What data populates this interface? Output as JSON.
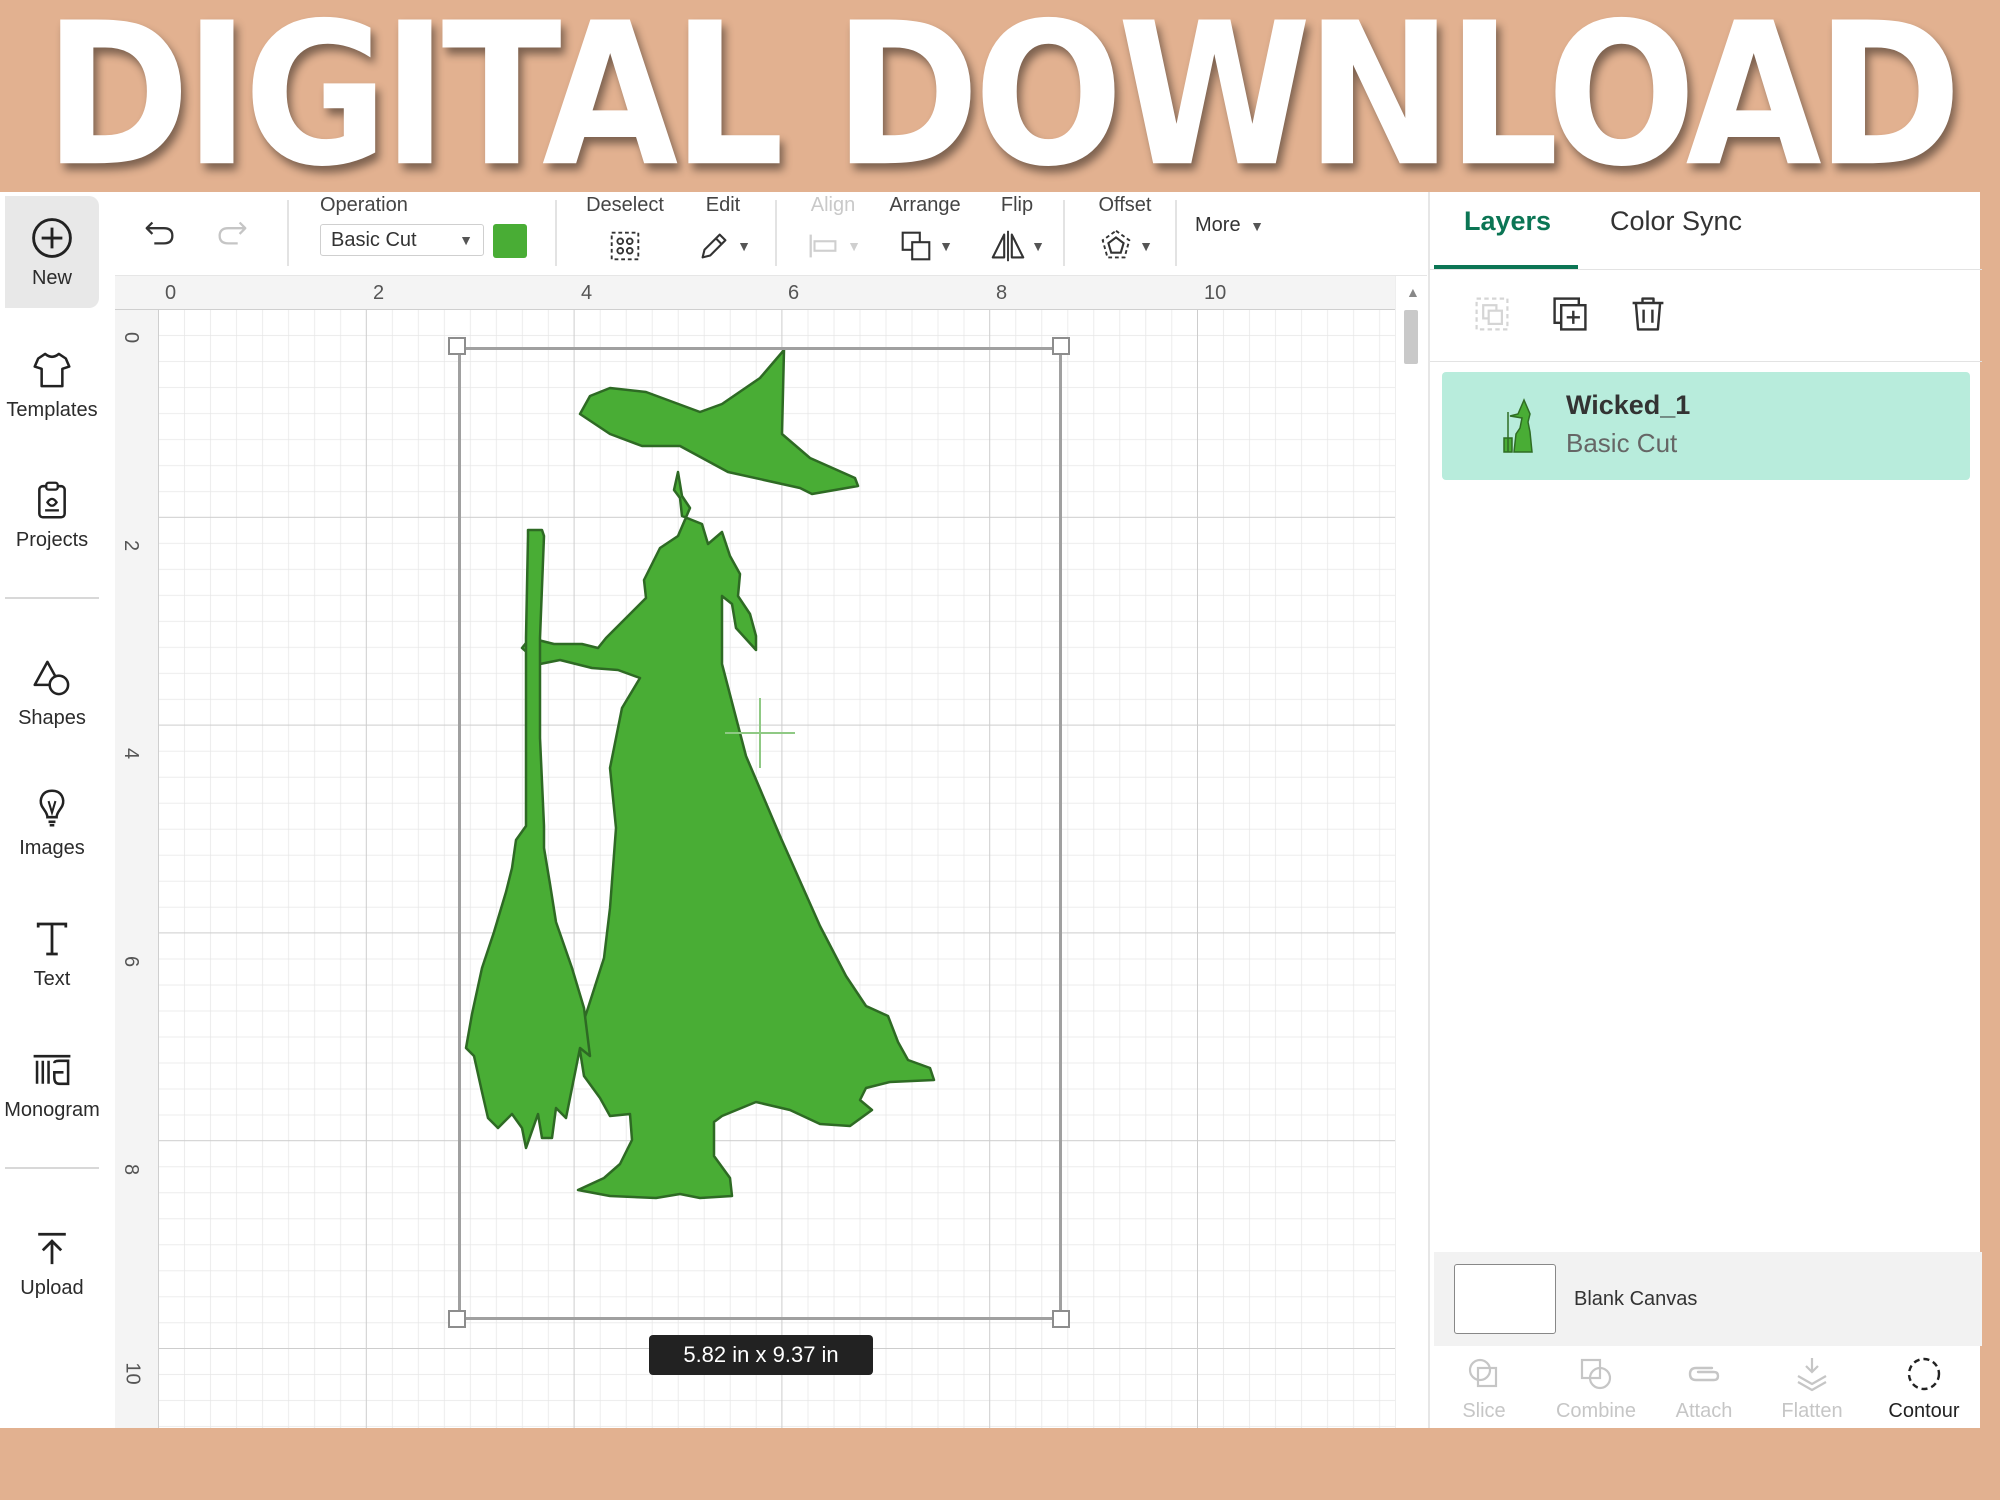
{
  "banner": {
    "title": "DIGITAL DOWNLOAD"
  },
  "leftnav": {
    "items": [
      {
        "label": "New",
        "icon": "plus-circle-icon"
      },
      {
        "label": "Templates",
        "icon": "tshirt-icon"
      },
      {
        "label": "Projects",
        "icon": "projects-icon"
      },
      {
        "label": "Shapes",
        "icon": "shapes-icon"
      },
      {
        "label": "Images",
        "icon": "lightbulb-icon"
      },
      {
        "label": "Text",
        "icon": "text-icon"
      },
      {
        "label": "Monogram",
        "icon": "monogram-icon"
      },
      {
        "label": "Upload",
        "icon": "upload-icon"
      }
    ]
  },
  "toolbar": {
    "operation_label": "Operation",
    "operation_value": "Basic Cut",
    "operation_color": "#49ad35",
    "deselect_label": "Deselect",
    "edit_label": "Edit",
    "align_label": "Align",
    "arrange_label": "Arrange",
    "flip_label": "Flip",
    "offset_label": "Offset",
    "more_label": "More"
  },
  "rulers": {
    "top": [
      "0",
      "2",
      "4",
      "6",
      "8",
      "10"
    ],
    "left": [
      "0",
      "2",
      "4",
      "6",
      "8",
      "10"
    ]
  },
  "canvas": {
    "dimensions": "5.82  in x 9.37  in",
    "shape_color": "#49ad35"
  },
  "panel": {
    "tabs": [
      "Layers",
      "Color Sync"
    ],
    "layer": {
      "name": "Wicked_1",
      "operation": "Basic Cut"
    },
    "blank_canvas_label": "Blank Canvas",
    "bottom_tools": [
      "Slice",
      "Combine",
      "Attach",
      "Flatten",
      "Contour"
    ]
  },
  "colors": {
    "accent": "#0b7554",
    "layer_highlight": "#b8ecdc",
    "background": "#e2b190"
  }
}
